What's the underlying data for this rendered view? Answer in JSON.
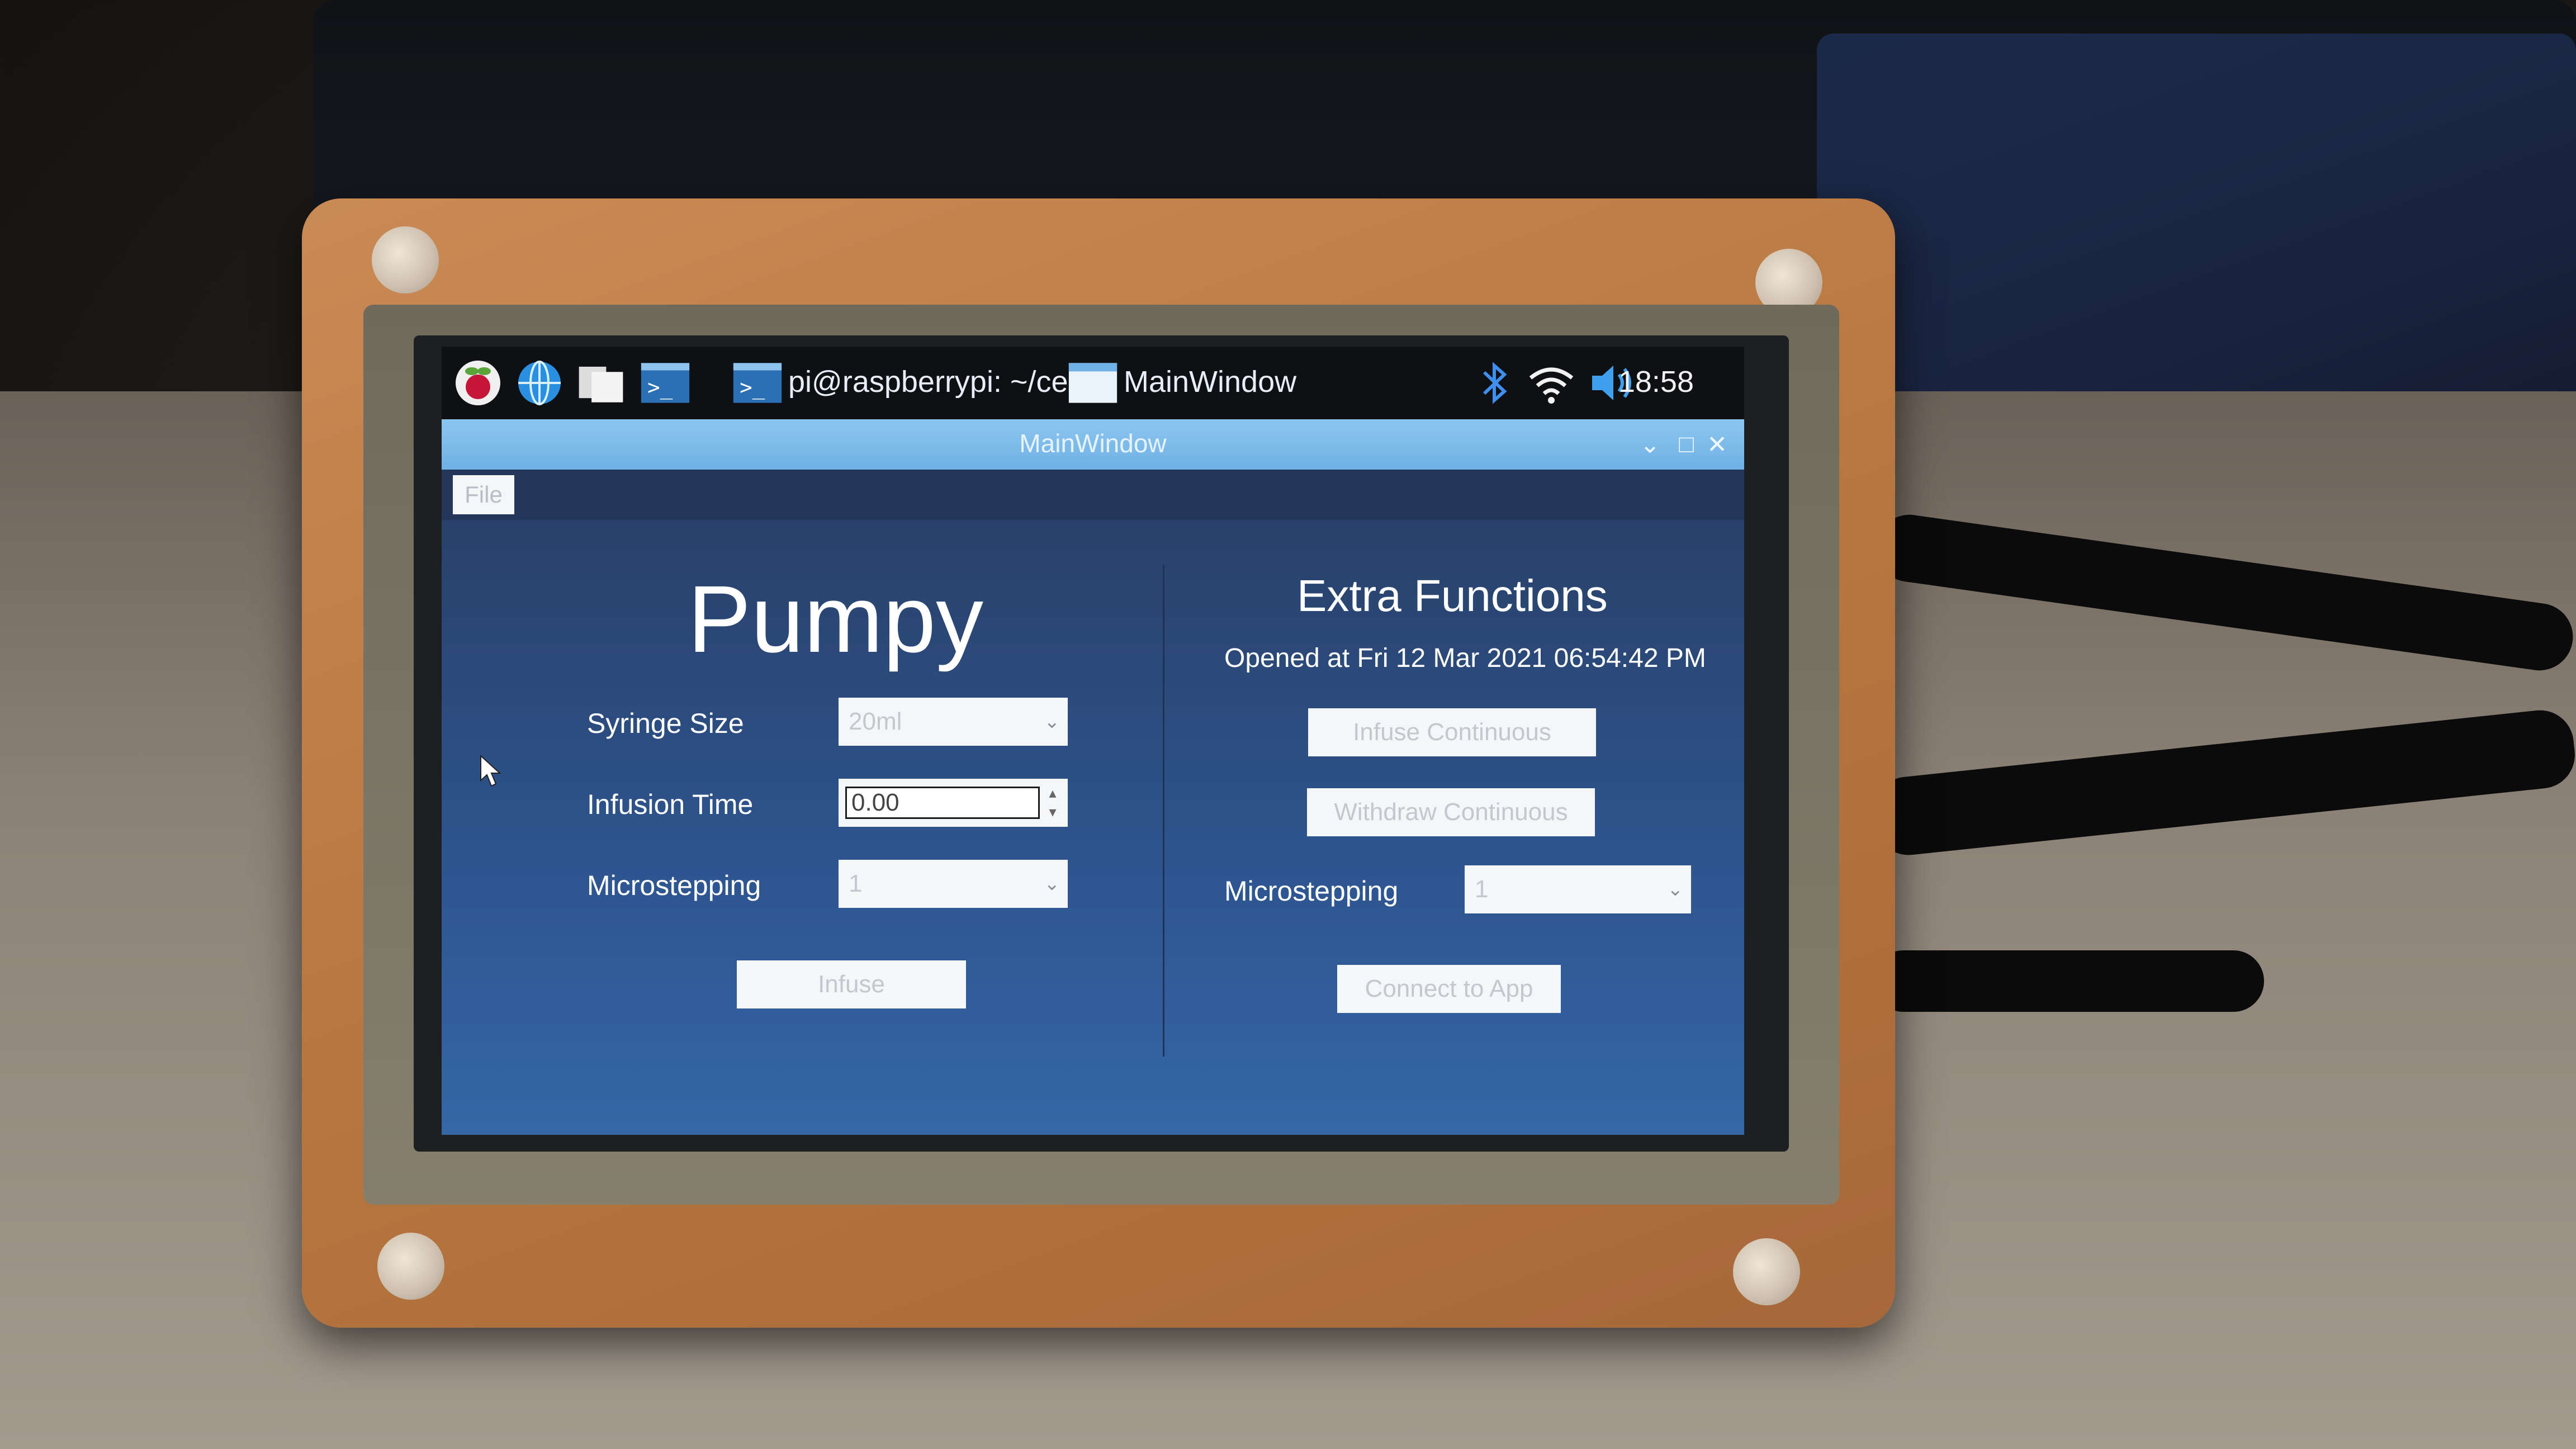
{
  "taskbar": {
    "terminal_label": "pi@raspberrypi: ~/ce...",
    "window_label": "MainWindow",
    "clock": "18:58",
    "icons": [
      "raspberry-menu-icon",
      "browser-icon",
      "file-manager-icon",
      "terminal-icon",
      "bluetooth-icon",
      "wifi-icon",
      "volume-icon"
    ]
  },
  "window": {
    "title": "MainWindow",
    "menu_file": "File"
  },
  "left_panel": {
    "title": "Pumpy",
    "syringe_size_label": "Syringe Size",
    "syringe_size_value": "20ml",
    "infusion_time_label": "Infusion Time",
    "infusion_time_value": "0.00",
    "microstepping_label": "Microstepping",
    "microstepping_value": "1",
    "infuse_button": "Infuse"
  },
  "right_panel": {
    "title": "Extra Functions",
    "opened_text": "Opened at Fri 12 Mar 2021 06:54:42 PM",
    "infuse_continuous_button": "Infuse Continuous",
    "withdraw_continuous_button": "Withdraw Continuous",
    "microstepping_label": "Microstepping",
    "microstepping_value": "1",
    "connect_button": "Connect to App"
  },
  "colors": {
    "titlebar": "#7fbcea",
    "content_bg": "#2e5691",
    "taskbar_bg": "#0f1014"
  }
}
